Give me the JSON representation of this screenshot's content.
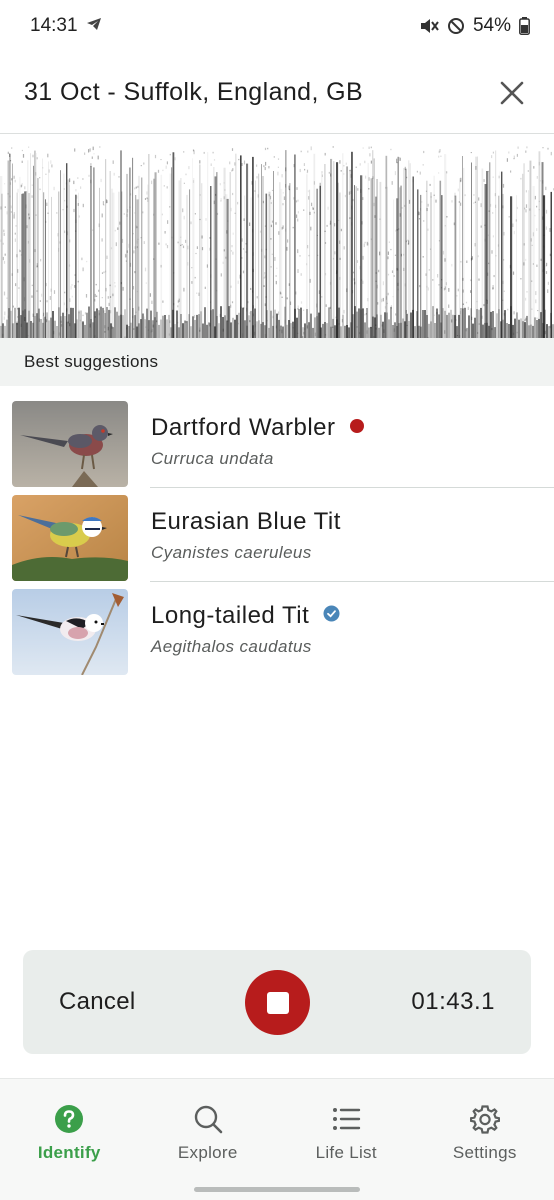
{
  "status_bar": {
    "time": "14:31",
    "battery": "54%"
  },
  "header": {
    "title": "31 Oct - Suffolk, England, GB"
  },
  "suggestions": {
    "heading": "Best suggestions",
    "items": [
      {
        "name": "Dartford Warbler",
        "scientific": "Curruca undata",
        "badge": "red-dot",
        "badge_color": "#b71c1c"
      },
      {
        "name": "Eurasian Blue Tit",
        "scientific": "Cyanistes caeruleus",
        "badge": "none"
      },
      {
        "name": "Long-tailed Tit",
        "scientific": "Aegithalos caudatus",
        "badge": "verified-check",
        "badge_color": "#4a86b8"
      }
    ]
  },
  "recorder": {
    "cancel_label": "Cancel",
    "timer": "01:43.1",
    "stop_color": "#b71c1c"
  },
  "nav": {
    "items": [
      {
        "label": "Identify",
        "icon": "question-circle-icon",
        "active": true
      },
      {
        "label": "Explore",
        "icon": "search-icon",
        "active": false
      },
      {
        "label": "Life List",
        "icon": "list-icon",
        "active": false
      },
      {
        "label": "Settings",
        "icon": "gear-icon",
        "active": false
      }
    ],
    "active_color": "#3b9f4a"
  }
}
